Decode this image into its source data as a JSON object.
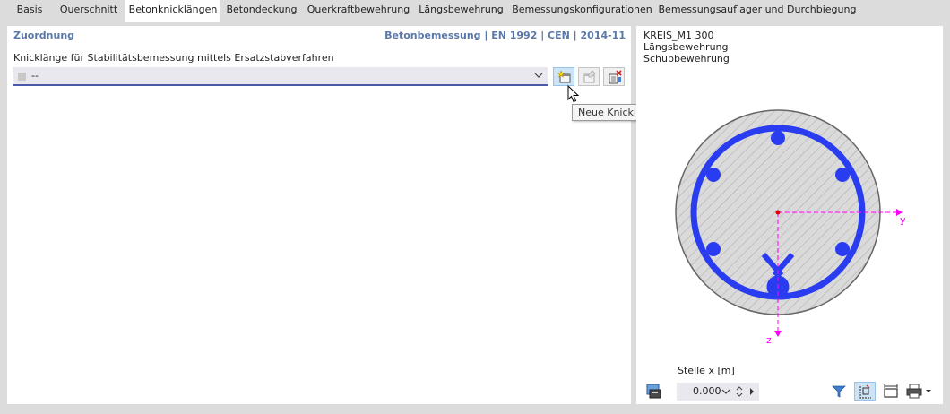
{
  "tabs": [
    {
      "label": "Basis"
    },
    {
      "label": "Querschnitt"
    },
    {
      "label": "Betonknicklängen"
    },
    {
      "label": "Betondeckung"
    },
    {
      "label": "Querkraftbewehrung"
    },
    {
      "label": "Längsbewehrung"
    },
    {
      "label": "Bemessungskonfigurationen"
    },
    {
      "label": "Bemessungsauflager und Durchbiegung"
    }
  ],
  "active_tab": "Betonknicklängen",
  "left": {
    "section_title": "Zuordnung",
    "norm": "Betonbemessung | EN 1992 | CEN | 2014-11",
    "field_label": "Knicklänge für Stabilitätsbemessung mittels Ersatzstabverfahren",
    "combo_value": "--",
    "tooltip": "Neue Knicklängen erzeugen..."
  },
  "right": {
    "section_name": "KREIS_M1 300",
    "line2": "Längsbewehrung",
    "line3": "Schubbewehrung",
    "axis_y": "y",
    "axis_z": "z",
    "stelle_label": "Stelle x [m]",
    "stelle_value": "0.000"
  },
  "colors": {
    "accent_text": "#5a78a8",
    "rebar": "#2a3cf0",
    "axis": "#ff00ff",
    "active_button": "#cde4f7"
  }
}
